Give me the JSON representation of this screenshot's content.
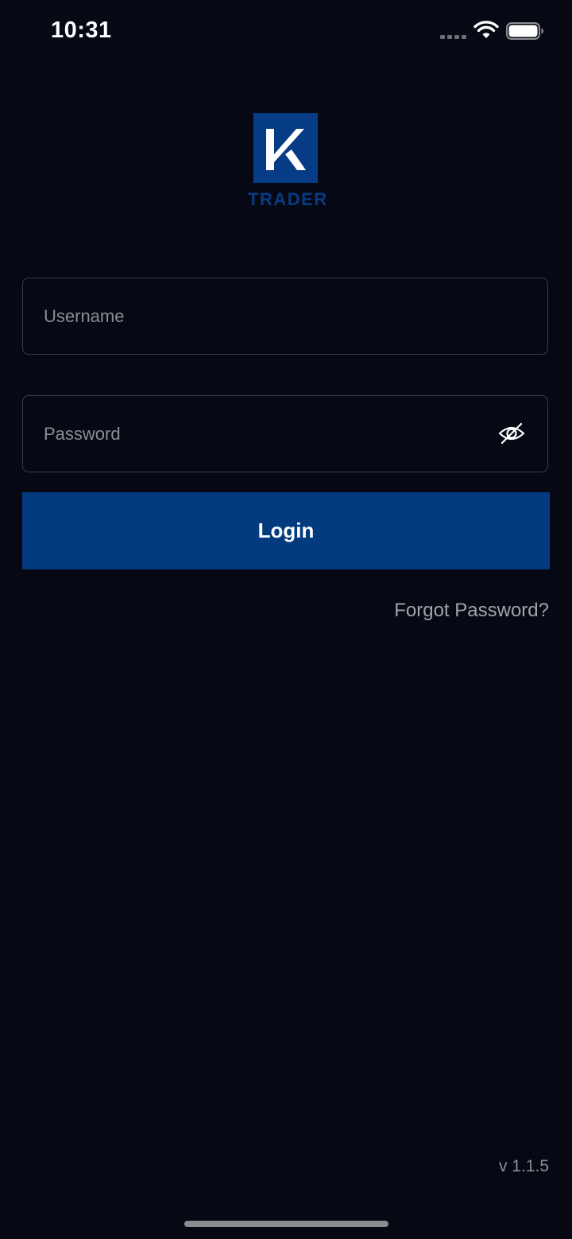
{
  "status_bar": {
    "time": "10:31"
  },
  "logo": {
    "letter": "K",
    "text": "TRADER",
    "color": "#063b86"
  },
  "form": {
    "username_placeholder": "Username",
    "username_value": "",
    "password_placeholder": "Password",
    "password_value": "",
    "login_label": "Login",
    "forgot_label": "Forgot Password?"
  },
  "footer": {
    "version": "v 1.1.5"
  },
  "colors": {
    "background": "#060913",
    "accent": "#043a7e",
    "field_border": "#3a3d44",
    "muted_text": "#8a8d93"
  }
}
